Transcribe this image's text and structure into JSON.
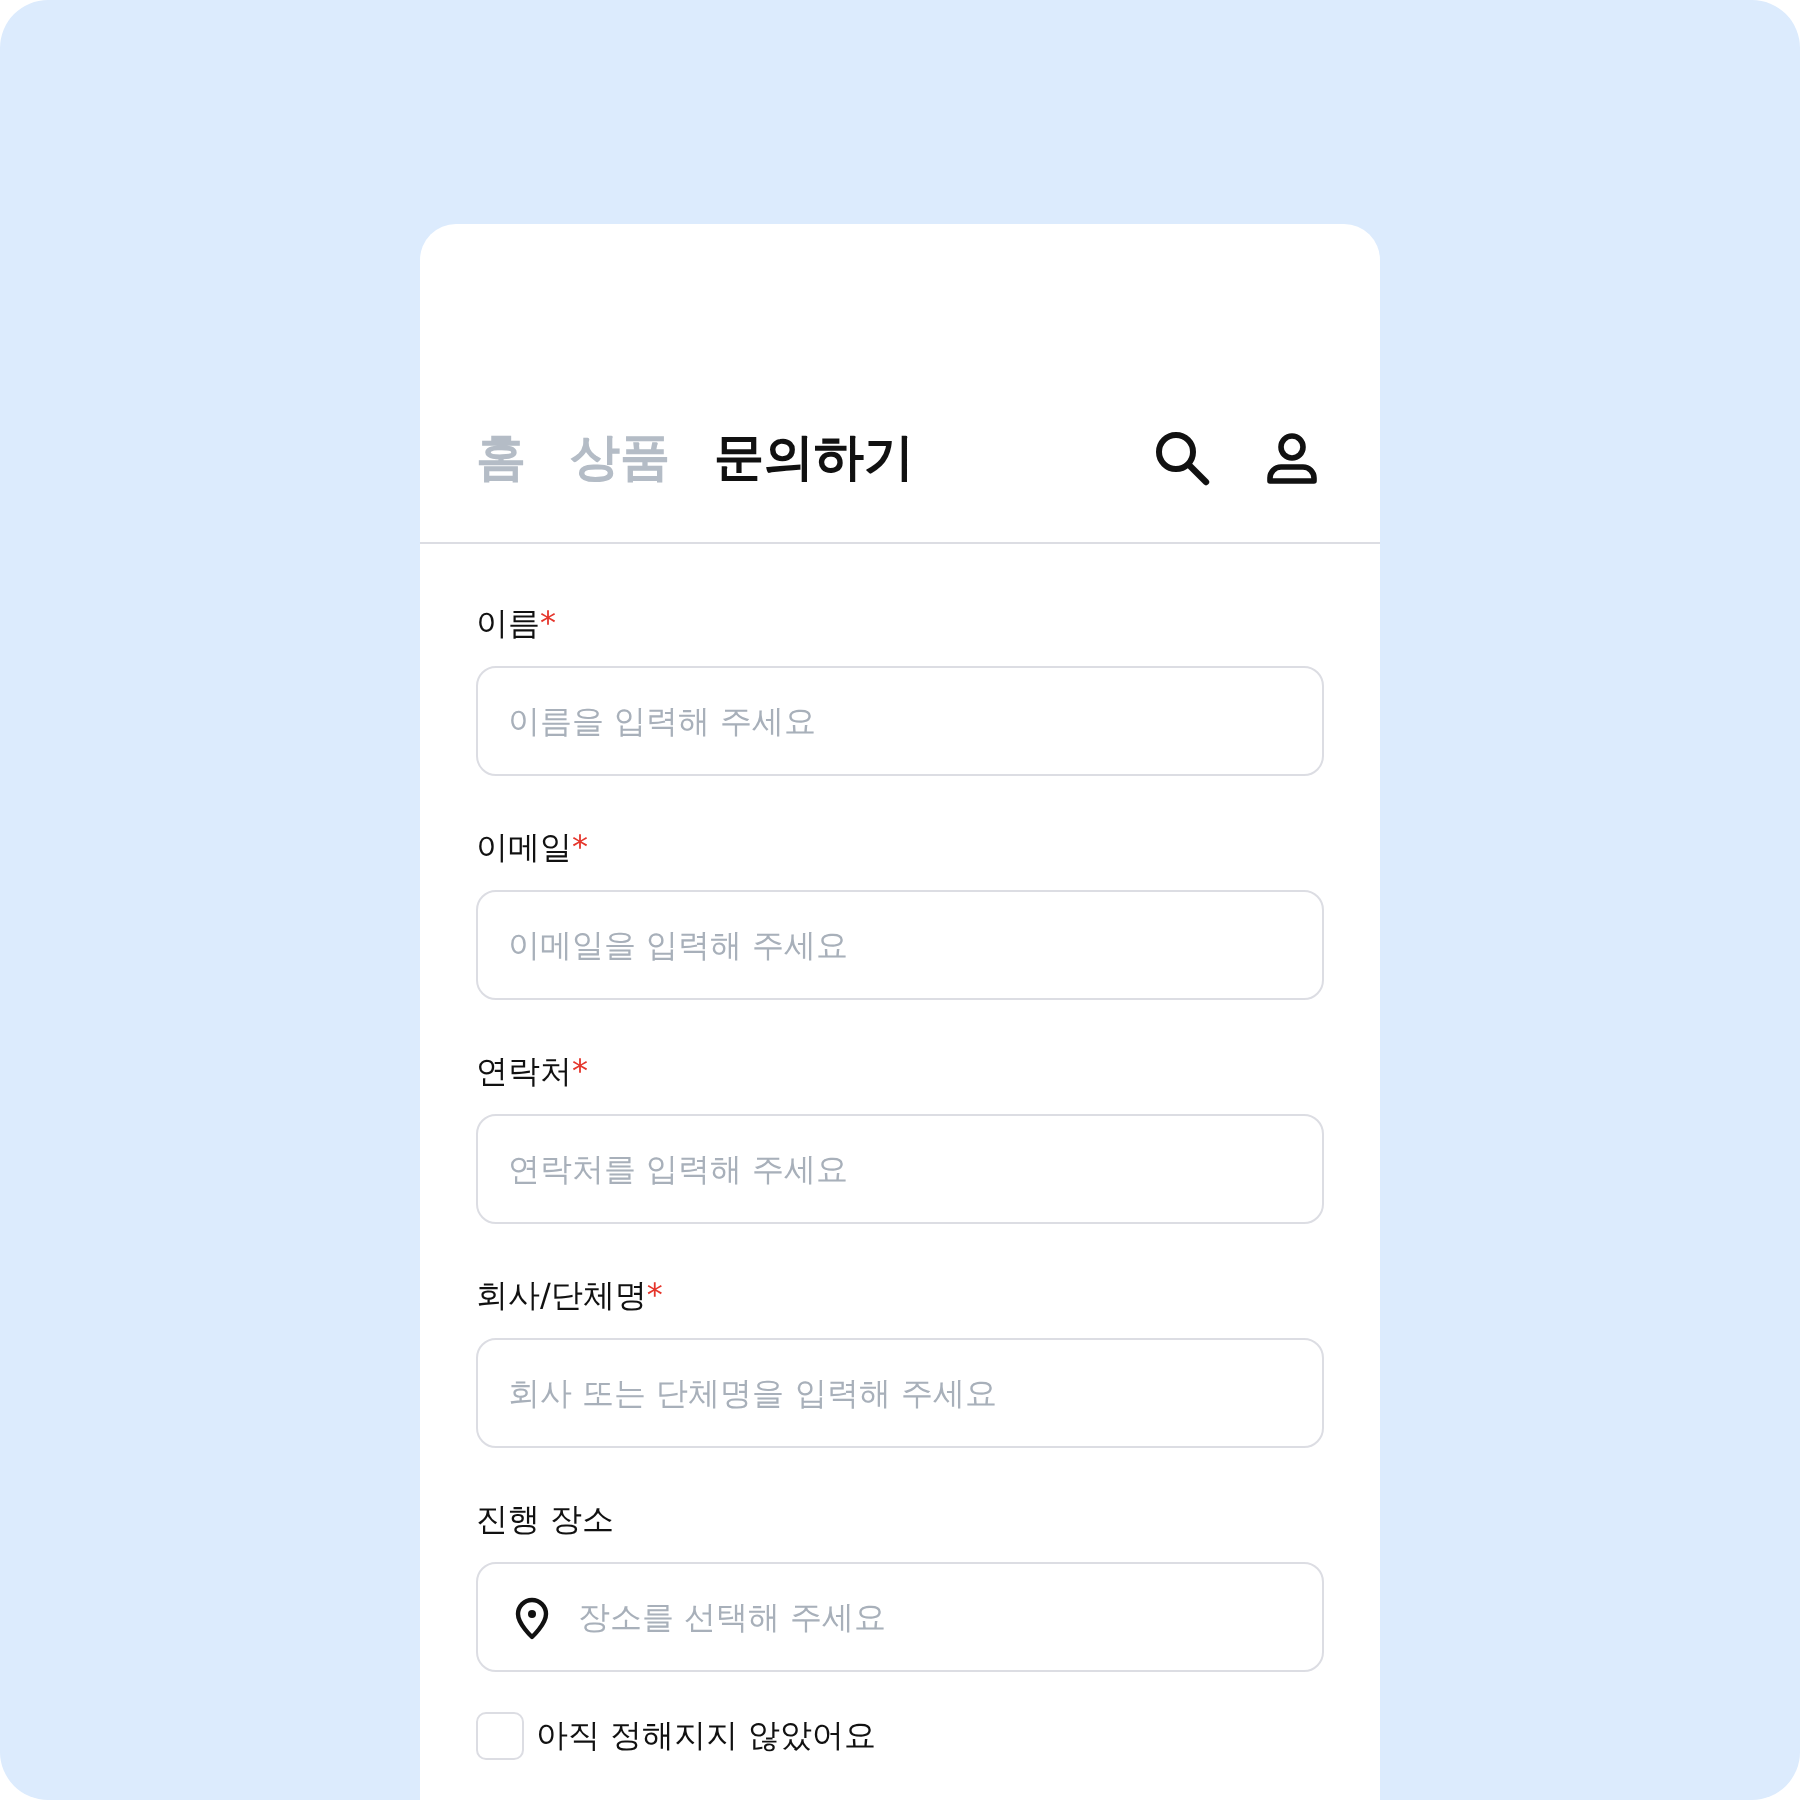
{
  "nav": {
    "tabs": [
      {
        "label": "홈",
        "selected": false
      },
      {
        "label": "상품",
        "selected": false
      },
      {
        "label": "문의하기",
        "selected": true
      }
    ]
  },
  "form": {
    "fields": [
      {
        "kind": "text",
        "label": "이름",
        "required": true,
        "placeholder": "이름을 입력해 주세요"
      },
      {
        "kind": "text",
        "label": "이메일",
        "required": true,
        "placeholder": "이메일을 입력해 주세요"
      },
      {
        "kind": "text",
        "label": "연락처",
        "required": true,
        "placeholder": "연락처를 입력해 주세요"
      },
      {
        "kind": "text",
        "label": "회사/단체명",
        "required": true,
        "placeholder": "회사 또는 단체명을 입력해 주세요"
      },
      {
        "kind": "location",
        "label": "진행 장소",
        "required": false,
        "placeholder": "장소를 선택해 주세요"
      }
    ],
    "required_mark": "*",
    "checkbox": {
      "label": "아직 정해지지 않았어요",
      "checked": false
    }
  }
}
